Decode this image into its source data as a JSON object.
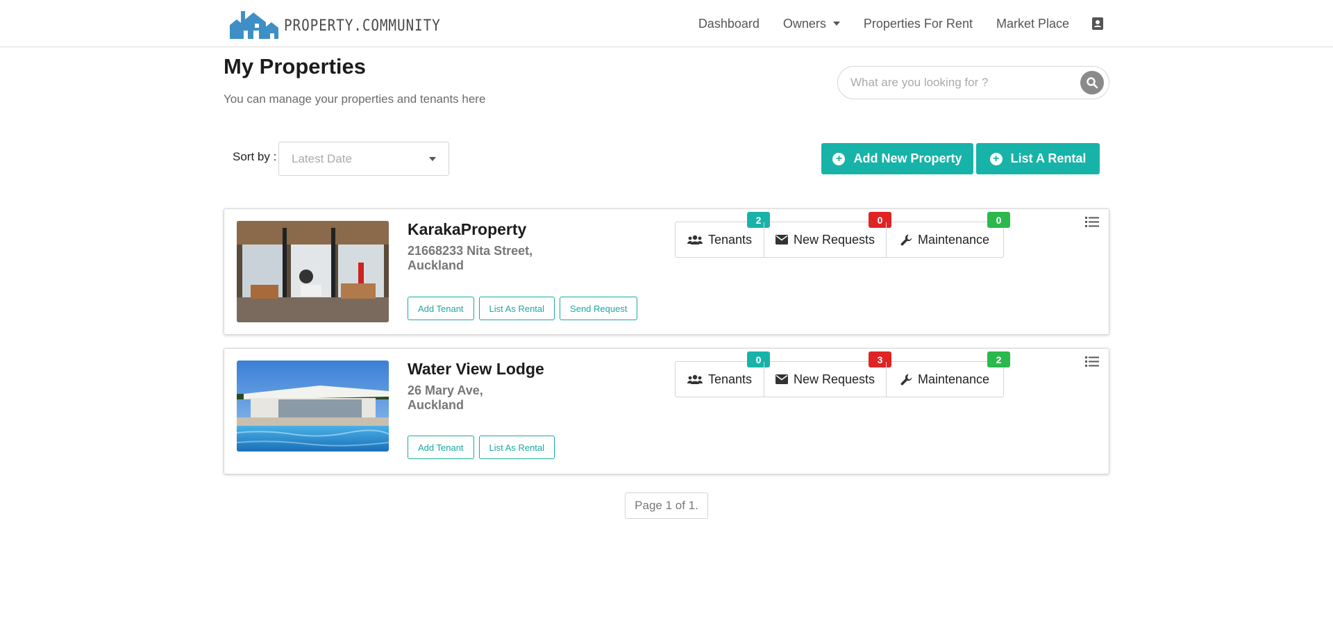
{
  "brand": {
    "logo_text": "PROPERTY.COMMUNITY",
    "logo_color": "#3d8fc6"
  },
  "nav": {
    "links": [
      "Dashboard",
      "Owners",
      "Properties For Rent",
      "Market Place"
    ],
    "user_icon": "contact-card-icon"
  },
  "header": {
    "title": "My Properties",
    "subtitle": "You can manage your properties and tenants here"
  },
  "search": {
    "placeholder": "What are you looking for ?",
    "icon": "search-icon"
  },
  "sort": {
    "label": "Sort by :",
    "value": "Latest Date"
  },
  "actions": {
    "add_property": "Add New Property",
    "list_rental": "List A Rental"
  },
  "colors": {
    "accent": "#17b3a9",
    "badge_teal": "#17b3a9",
    "badge_red": "#e02424",
    "badge_green": "#2bb84c"
  },
  "stat_labels": {
    "tenants": "Tenants",
    "requests": "New Requests",
    "maintenance": "Maintenance"
  },
  "properties": [
    {
      "name": "KarakaProperty",
      "address_line1": "21668233 Nita Street,",
      "address_line2": "Auckland",
      "tenants_count": "2",
      "requests_count": "0",
      "maintenance_count": "0",
      "buttons": [
        "Add Tenant",
        "List As Rental",
        "Send Request"
      ]
    },
    {
      "name": "Water View Lodge",
      "address_line1": "26 Mary Ave,",
      "address_line2": "Auckland",
      "tenants_count": "0",
      "requests_count": "3",
      "maintenance_count": "2",
      "buttons": [
        "Add Tenant",
        "List As Rental"
      ]
    }
  ],
  "pagination": {
    "text": "Page 1 of 1."
  }
}
